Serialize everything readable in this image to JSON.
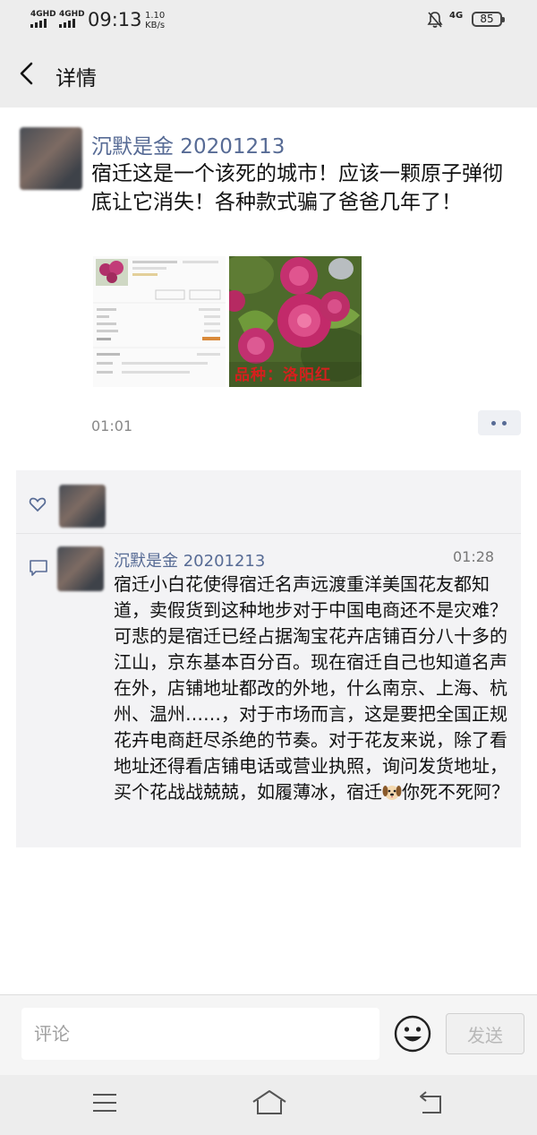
{
  "status_bar": {
    "signal1": "4GHD",
    "signal2": "4GHD",
    "time": "09:13",
    "speed_value": "1.10",
    "speed_unit": "KB/s",
    "network": "4G",
    "battery": "85"
  },
  "header": {
    "title": "详情"
  },
  "post": {
    "author": "沉默是金  20201213",
    "text": "宿迁这是一个该死的城市！应该一颗原子弹彻底让它消失！各种款式骗了爸爸几年了！",
    "image_caption": "品种：洛阳红",
    "time": "01:01"
  },
  "comment": {
    "author": "沉默是金  20201213",
    "time": "01:28",
    "text_before": "宿迁小白花使得宿迁名声远渡重洋美国花友都知道，卖假货到这种地步对于中国电商还不是灾难？可悲的是宿迁已经占据淘宝花卉店铺百分八十多的江山，京东基本百分百。现在宿迁自己也知道名声在外，店铺地址都改的外地，什么南京、上海、杭州、温州……，对于市场而言，这是要把全国正规花卉电商赶尽杀绝的节奏。对于花友来说，除了看地址还得看店铺电话或营业执照，询问发货地址，买个花战战兢兢，如履薄冰，宿迁",
    "text_after": "你死不死阿？"
  },
  "comment_bar": {
    "placeholder": "评论",
    "send_label": "发送"
  },
  "colors": {
    "link_blue": "#576b95",
    "background": "#ededed"
  }
}
